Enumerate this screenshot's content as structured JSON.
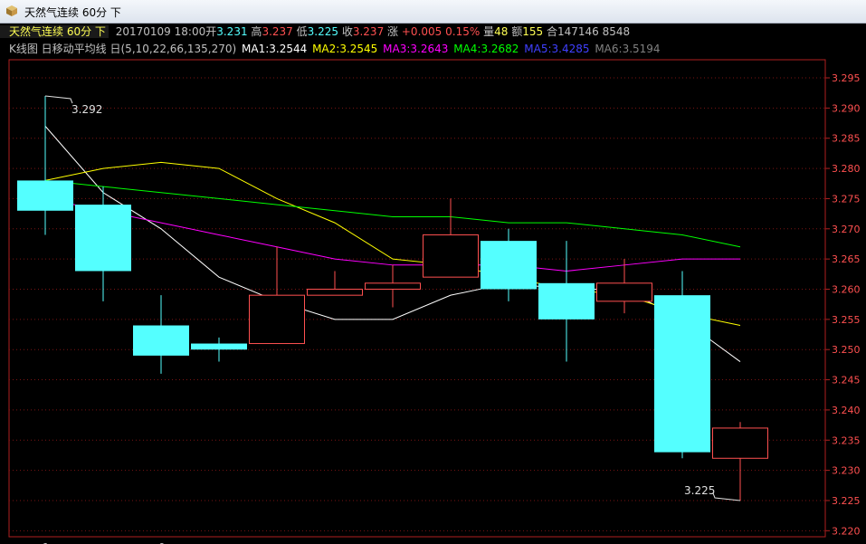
{
  "window": {
    "title": "天然气连续 60分 下"
  },
  "info": {
    "name": "天然气连续 60分 下",
    "date_time": "20170109 18:00",
    "open_label": "开",
    "open": "3.231",
    "high_label": "高",
    "high": "3.237",
    "low_label": "低",
    "low": "3.225",
    "close_label": "收",
    "close": "3.237",
    "change_label": "涨",
    "change": "+0.005",
    "change_pct": "0.15%",
    "volume_label": "量",
    "volume": "48",
    "amount_label": "额",
    "amount": "155",
    "oi_label": "合",
    "oi": "147146",
    "extra": "8548"
  },
  "ma_bar": {
    "indicator": "K线图 日移动平均线 日(5,10,22,66,135,270)",
    "ma1": "MA1:3.2544",
    "ma2": "MA2:3.2545",
    "ma3": "MA3:3.2643",
    "ma4": "MA4:3.2682",
    "ma5": "MA5:3.4285",
    "ma6": "MA6:3.5194"
  },
  "colors": {
    "up": "#ff5050",
    "down": "#54ffff",
    "grid": "#7a1414",
    "axis": "#b02020",
    "text": "#c0c0c0",
    "ma1": "#ffffff",
    "ma2": "#ffff00",
    "ma3": "#ff00ff",
    "ma4": "#00ff00",
    "ma5": "#4040ff",
    "ma6": "#808080",
    "label_yellow": "#ffff54"
  },
  "chart_data": {
    "type": "candlestick",
    "ylim": [
      3.219,
      3.298
    ],
    "yticks": [
      "3.220",
      "3.225",
      "3.230",
      "3.235",
      "3.240",
      "3.245",
      "3.250",
      "3.255",
      "3.260",
      "3.265",
      "3.270",
      "3.275",
      "3.280",
      "3.285",
      "3.290",
      "3.295"
    ],
    "candles": [
      {
        "open": 3.278,
        "high": 3.292,
        "low": 3.269,
        "close": 3.273
      },
      {
        "open": 3.274,
        "high": 3.277,
        "low": 3.258,
        "close": 3.263
      },
      {
        "open": 3.254,
        "high": 3.259,
        "low": 3.246,
        "close": 3.249
      },
      {
        "open": 3.251,
        "high": 3.252,
        "low": 3.248,
        "close": 3.25
      },
      {
        "open": 3.251,
        "high": 3.267,
        "low": 3.251,
        "close": 3.259
      },
      {
        "open": 3.259,
        "high": 3.263,
        "low": 3.259,
        "close": 3.26
      },
      {
        "open": 3.26,
        "high": 3.264,
        "low": 3.257,
        "close": 3.261
      },
      {
        "open": 3.262,
        "high": 3.275,
        "low": 3.262,
        "close": 3.269
      },
      {
        "open": 3.268,
        "high": 3.27,
        "low": 3.258,
        "close": 3.26
      },
      {
        "open": 3.261,
        "high": 3.268,
        "low": 3.248,
        "close": 3.255
      },
      {
        "open": 3.258,
        "high": 3.265,
        "low": 3.256,
        "close": 3.261
      },
      {
        "open": 3.259,
        "high": 3.263,
        "low": 3.232,
        "close": 3.233
      },
      {
        "open": 3.232,
        "high": 3.238,
        "low": 3.225,
        "close": 3.237
      }
    ],
    "ma_lines": [
      {
        "name": "MA1",
        "color": "#ffffff",
        "values": [
          3.287,
          3.276,
          3.27,
          3.262,
          3.258,
          3.255,
          3.255,
          3.259,
          3.261,
          3.26,
          3.26,
          3.255,
          3.248
        ]
      },
      {
        "name": "MA2",
        "color": "#ffff00",
        "values": [
          3.278,
          3.28,
          3.281,
          3.28,
          3.275,
          3.271,
          3.265,
          3.264,
          3.262,
          3.26,
          3.259,
          3.256,
          3.254
        ]
      },
      {
        "name": "MA3",
        "color": "#ff00ff",
        "values": [
          3.275,
          3.273,
          3.271,
          3.269,
          3.267,
          3.265,
          3.264,
          3.264,
          3.264,
          3.263,
          3.264,
          3.265,
          3.265
        ]
      },
      {
        "name": "MA4",
        "color": "#00ff00",
        "values": [
          3.278,
          3.277,
          3.276,
          3.275,
          3.274,
          3.273,
          3.272,
          3.272,
          3.271,
          3.271,
          3.27,
          3.269,
          3.267
        ]
      }
    ],
    "annotations": [
      {
        "text": "3.292",
        "index": 0,
        "value": 3.292,
        "side": "right"
      },
      {
        "text": "3.225",
        "index": 12,
        "value": 3.225,
        "side": "left"
      }
    ],
    "x_markers": [
      "1",
      "0"
    ]
  }
}
